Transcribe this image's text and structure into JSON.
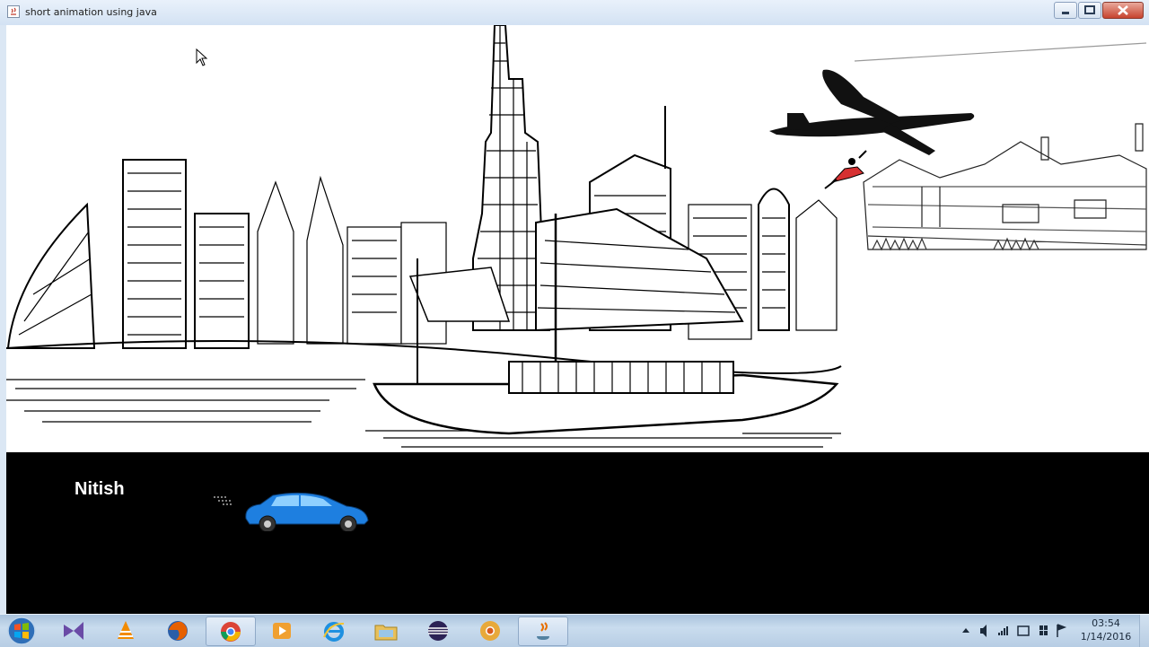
{
  "window": {
    "title": "short animation using java",
    "buttons": [
      "minimize",
      "maximize",
      "close"
    ]
  },
  "game": {
    "player_name": "Nitish",
    "scene": "city skyline with sailing boats, airplane, skydiver and cottages",
    "road_color": "#000000",
    "car_color": "#1e7fe0"
  },
  "taskbar": {
    "apps": [
      {
        "icon": "visual-studio-icon"
      },
      {
        "icon": "vlc-icon"
      },
      {
        "icon": "firefox-icon"
      },
      {
        "icon": "chrome-icon",
        "active": true
      },
      {
        "icon": "media-player-icon"
      },
      {
        "icon": "internet-explorer-icon"
      },
      {
        "icon": "file-explorer-icon"
      },
      {
        "icon": "eclipse-icon"
      },
      {
        "icon": "chrome-canary-icon"
      },
      {
        "icon": "java-icon",
        "active": true
      }
    ],
    "clock_time": "03:54",
    "clock_date": "1/14/2016"
  }
}
